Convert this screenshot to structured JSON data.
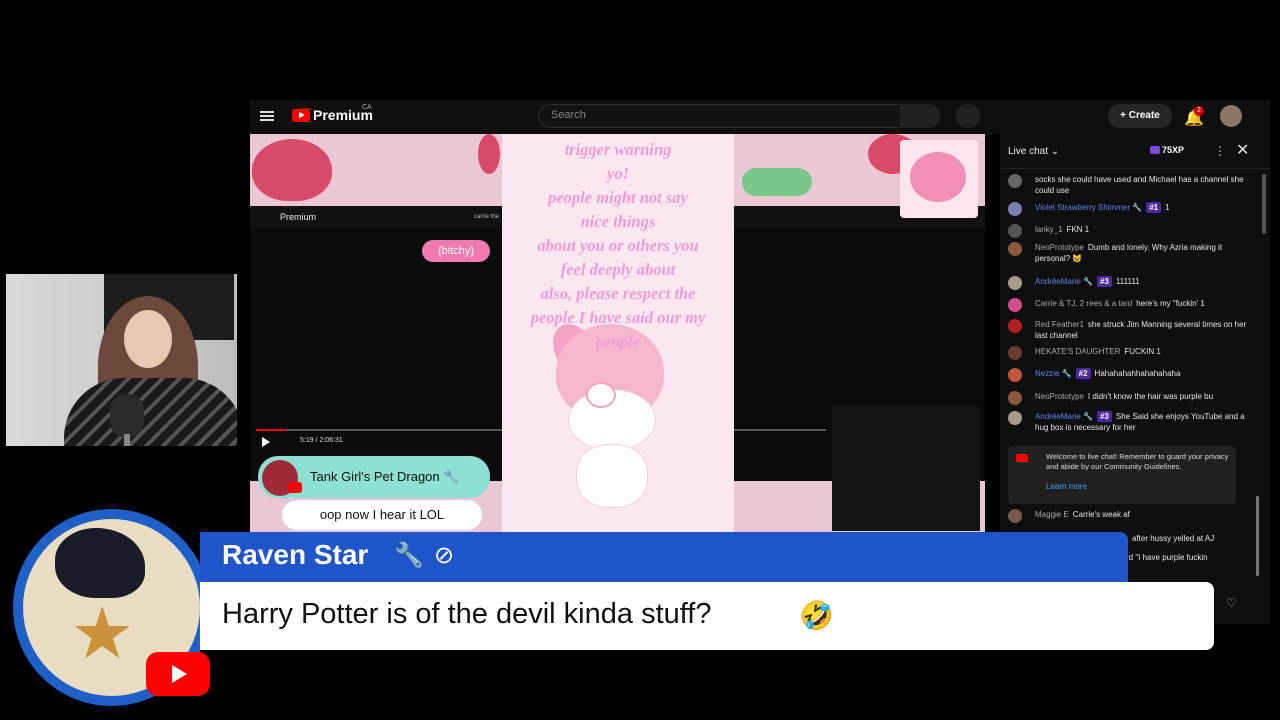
{
  "youtube": {
    "brand": "Premium",
    "brand_sup": "CA",
    "search_placeholder": "Search",
    "create_label": "+ Create",
    "notification_count": "2"
  },
  "video": {
    "overlay_text": "trigger warning\nyo!\npeople might not say\nnice things\nabout you or others you\nfeel deeply about\nalso, please respect the\npeople I have said our my\npeople",
    "tag": "{bitchy}",
    "time": "5:19 / 2:06:31",
    "inner_brand": "Premium",
    "inner_search": "carrie the"
  },
  "superchat": {
    "name": "Tank Girl's Pet Dragon 🔧",
    "message": "oop now I hear it LOL"
  },
  "live_chat": {
    "title": "Live chat ⌄",
    "xp": "75XP",
    "messages": [
      {
        "author": "",
        "text": "socks she could have used and Michael has a channel she could use",
        "avatar": "#666"
      },
      {
        "author": "Violet Strawberry Shimmer 🔧",
        "mod": true,
        "badge": "#1",
        "text": "1",
        "avatar": "#7a7fb0"
      },
      {
        "author": "lanky_1",
        "text": "FKN 1",
        "avatar": "#555"
      },
      {
        "author": "NeoPrototype",
        "text": "Dumb and lonely. Why Azria making it personal? 😺",
        "avatar": "#8a5a3a"
      },
      {
        "author": "AndréeMarie 🔧",
        "mod": true,
        "badge": "#3",
        "text": "111111",
        "avatar": "#a89a88"
      },
      {
        "author": "Carrie & TJ, 2 rees & a tard",
        "text": "here's my \"fuckin' 1",
        "avatar": "#d04d8a"
      },
      {
        "author": "Red Feather1",
        "text": "she struck Jim Manning several times on her last channel",
        "avatar": "#b22222"
      },
      {
        "author": "HEKATE'S DAUGHTER",
        "text": "FUCKIN 1",
        "avatar": "#6b3b2e"
      },
      {
        "author": "Nezzie 🔧",
        "mod": true,
        "badge": "#2",
        "text": "Hahahahahhahahahaha",
        "avatar": "#c0563a"
      },
      {
        "author": "NeoPrototype",
        "text": "I didn't know the hair was purple bu",
        "avatar": "#8a5a3a"
      },
      {
        "author": "AndréeMarie 🔧",
        "mod": true,
        "badge": "#3",
        "text": "She Said she enjoys YouTube and a hug box is necessary for her",
        "avatar": "#a89a88"
      },
      {
        "author": "Maggie E",
        "text": "Carrie's weak af",
        "avatar": "#7a5a4a"
      }
    ],
    "partial_1": "after hussy yelled at AJ",
    "partial_2": "rd  \"I have purple fuckin",
    "notice": "Welcome to live chat! Remember to guard your privacy and abide by our Community Guidelines.",
    "learn_more": "Learn more"
  },
  "lower_third": {
    "name": "Raven Star",
    "message": "Harry Potter is of the devil kinda stuff?",
    "emoji": "🤣"
  }
}
